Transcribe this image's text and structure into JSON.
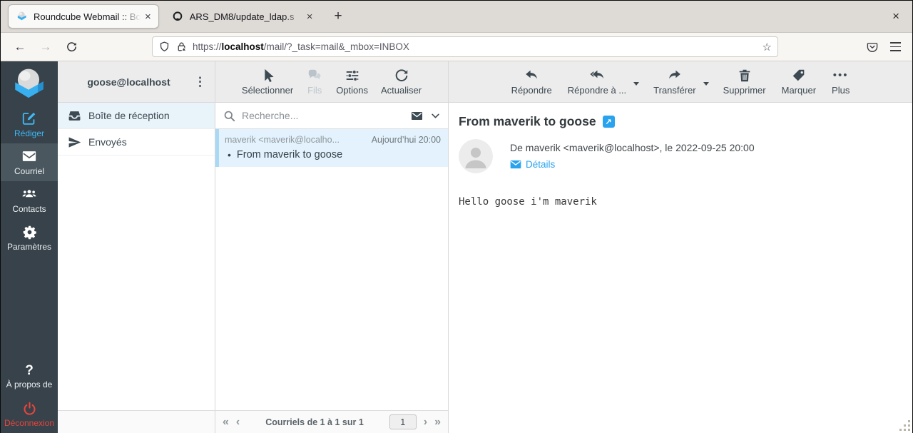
{
  "browser": {
    "tabs": [
      {
        "title": "Roundcube Webmail :: Bo"
      },
      {
        "title": "ARS_DM8/update_ldap.s"
      }
    ],
    "url": {
      "scheme": "https://",
      "host": "localhost",
      "path": "/mail/?_task=mail&_mbox=INBOX"
    }
  },
  "icons": {
    "close": "×",
    "plus": "+",
    "back": "←",
    "forward": "→",
    "star": "☆",
    "kebab": "⋮",
    "bullet": "•",
    "ellipsis": "•••",
    "question": "?",
    "external_link": "↗",
    "page_first": "«",
    "page_prev": "‹",
    "page_next": "›",
    "page_last": "»"
  },
  "taskmenu": {
    "items": [
      {
        "label": "Rédiger"
      },
      {
        "label": "Courriel"
      },
      {
        "label": "Contacts"
      },
      {
        "label": "Paramètres"
      }
    ],
    "about": "À propos de",
    "logout": "Déconnexion"
  },
  "folders": {
    "account": "goose@localhost",
    "items": [
      {
        "label": "Boîte de réception"
      },
      {
        "label": "Envoyés"
      }
    ]
  },
  "list": {
    "toolbar": [
      {
        "label": "Sélectionner"
      },
      {
        "label": "Fils"
      },
      {
        "label": "Options"
      },
      {
        "label": "Actualiser"
      }
    ],
    "search_placeholder": "Recherche...",
    "messages": [
      {
        "sender": "maverik <maverik@localho...",
        "date": "Aujourd’hui 20:00",
        "subject": "From maverik to goose"
      }
    ],
    "pagination": {
      "label": "Courriels de 1 à 1 sur 1",
      "page": "1"
    }
  },
  "message": {
    "toolbar": [
      {
        "label": "Répondre"
      },
      {
        "label": "Répondre à ..."
      },
      {
        "label": "Transférer"
      },
      {
        "label": "Supprimer"
      },
      {
        "label": "Marquer"
      },
      {
        "label": "Plus"
      }
    ],
    "subject": "From maverik to goose",
    "from_line": "De maverik <maverik@localhost>, le 2022-09-25 20:00",
    "details_label": "Détails",
    "body": "Hello goose i'm maverik"
  },
  "colors": {
    "accent": "#2aa3ef",
    "sidebar_bg": "#37424a",
    "sidebar_selected": "#4a575f",
    "selected_row": "#e3f2fc",
    "danger": "#e8453c",
    "toolbar_bg": "#ececec"
  }
}
